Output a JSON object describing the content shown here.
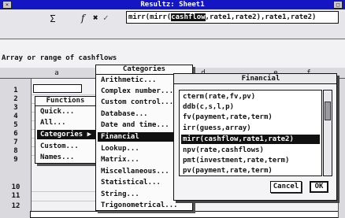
{
  "window": {
    "title": "Resultz: Sheet1",
    "close_glyph": "×",
    "max_glyph": "□"
  },
  "toolbar": {
    "sum_symbol": "Σ",
    "fx_symbol": "f",
    "cancel_symbol": "✖",
    "ok_symbol": "✓",
    "formula_prefix": "mirr(mirr(",
    "formula_highlight": "cashflow",
    "formula_suffix": ",rate1,rate2),rate1,rate2)"
  },
  "sheet": {
    "prompt": "Array or range of cashflows",
    "column_headers": [
      "a",
      "d",
      "e",
      "f"
    ],
    "row_numbers": [
      "1",
      "2",
      "3",
      "4",
      "5",
      "6",
      "7",
      "8",
      "9",
      "10",
      "11",
      "12"
    ]
  },
  "functions_menu": {
    "title": "Functions",
    "items": [
      "Quick...",
      "All...",
      "Categories ▶",
      "Custom...",
      "Names..."
    ],
    "selected_index": 2
  },
  "categories_menu": {
    "title": "Categories",
    "items": [
      "Arithmetic...",
      "Complex number...",
      "Custom control...",
      "Database...",
      "Date and time...",
      "Financial",
      "Lookup...",
      "Matrix...",
      "Miscellaneous...",
      "Statistical...",
      "String...",
      "Trigonometrical..."
    ],
    "selected_index": 5
  },
  "financial_dialog": {
    "title": "Financial",
    "items": [
      "cterm(rate,fv,pv)",
      "ddb(c,s,l,p)",
      "fv(payment,rate,term)",
      "irr(guess,array)",
      "mirr(cashflow,rate1,rate2)",
      "npv(rate,cashflows)",
      "pmt(investment,rate,term)",
      "pv(payment,rate,term)"
    ],
    "selected_index": 4,
    "cancel_label": "Cancel",
    "ok_label": "OK"
  },
  "colors": {
    "background": "#0a0cc2",
    "selection": "#111111"
  }
}
